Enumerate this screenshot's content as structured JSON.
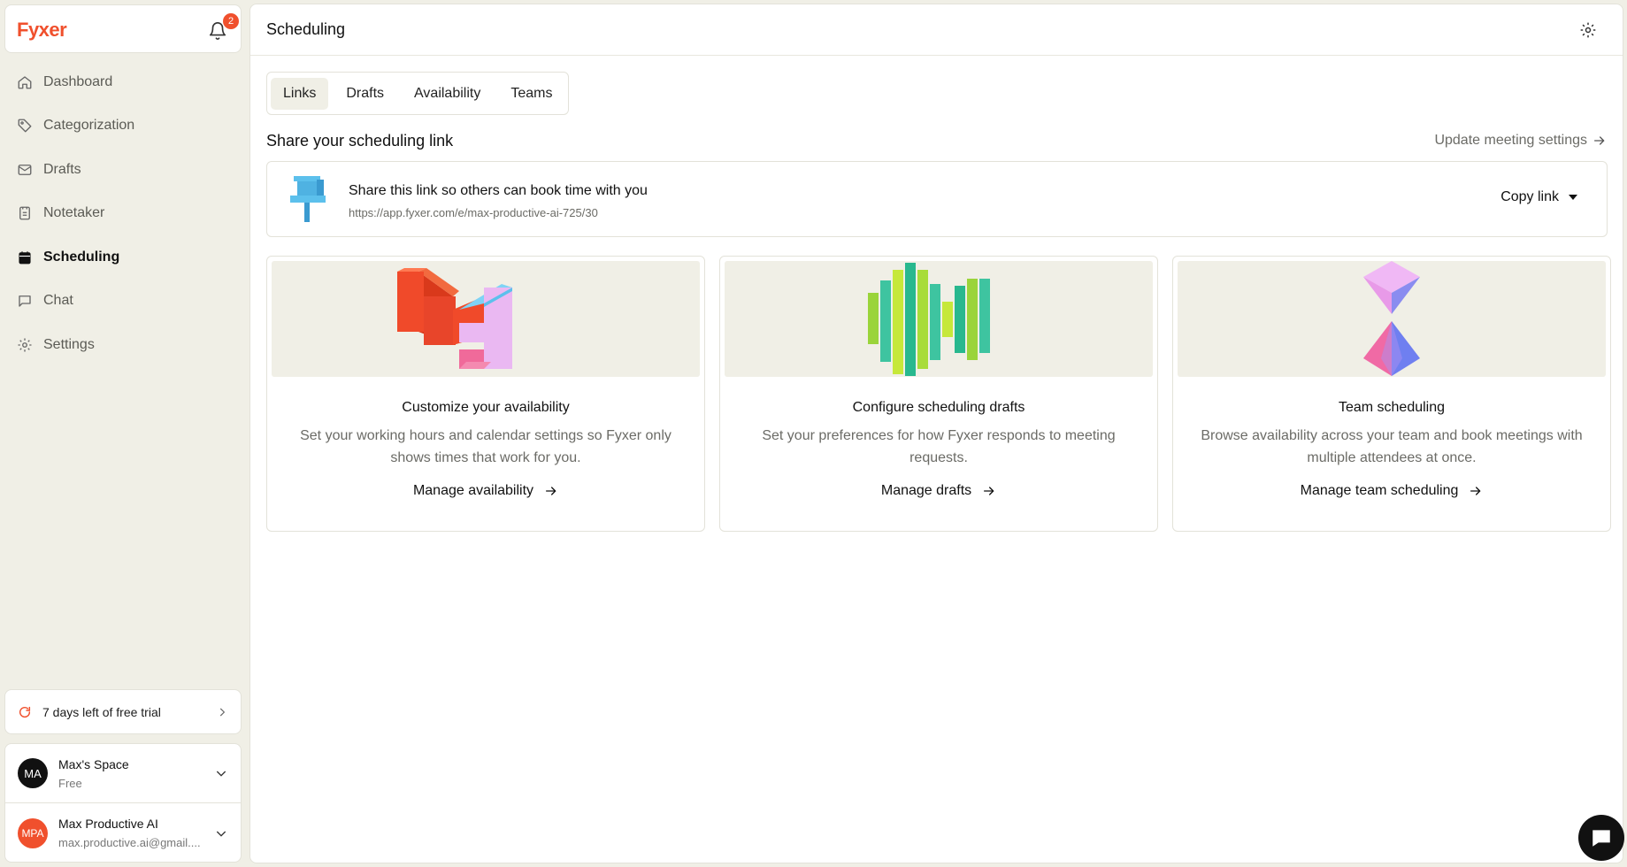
{
  "brand": {
    "name": "Fyxer",
    "notification_count": "2"
  },
  "sidebar": {
    "items": [
      {
        "label": "Dashboard",
        "icon": "home-icon"
      },
      {
        "label": "Categorization",
        "icon": "tag-icon"
      },
      {
        "label": "Drafts",
        "icon": "mail-icon"
      },
      {
        "label": "Notetaker",
        "icon": "notebook-icon"
      },
      {
        "label": "Scheduling",
        "icon": "calendar-icon",
        "active": true
      },
      {
        "label": "Chat",
        "icon": "chat-icon"
      },
      {
        "label": "Settings",
        "icon": "gear-icon"
      }
    ],
    "trial": "7 days left of free trial",
    "workspace": {
      "initials": "MA",
      "name": "Max's Space",
      "plan": "Free"
    },
    "user": {
      "initials": "MPA",
      "name": "Max Productive AI",
      "email": "max.productive.ai@gmail...."
    }
  },
  "header": {
    "title": "Scheduling"
  },
  "tabs": [
    "Links",
    "Drafts",
    "Availability",
    "Teams"
  ],
  "share": {
    "section_title": "Share your scheduling link",
    "update_link": "Update meeting settings",
    "title": "Share this link so others can book time with you",
    "url": "https://app.fyxer.com/e/max-productive-ai-725/30",
    "copy_label": "Copy link"
  },
  "cards": [
    {
      "title": "Customize your availability",
      "description": "Set your working hours and calendar settings so Fyxer only shows times that work for you.",
      "action": "Manage availability"
    },
    {
      "title": "Configure scheduling drafts",
      "description": "Set your preferences for how Fyxer responds to meeting requests.",
      "action": "Manage drafts"
    },
    {
      "title": "Team scheduling",
      "description": "Browse availability across your team and book meetings with multiple attendees at once.",
      "action": "Manage team scheduling"
    }
  ],
  "colors": {
    "brand": "#f0502d",
    "sidebar_bg": "#f0efe6",
    "panel_bg": "#ffffff"
  }
}
